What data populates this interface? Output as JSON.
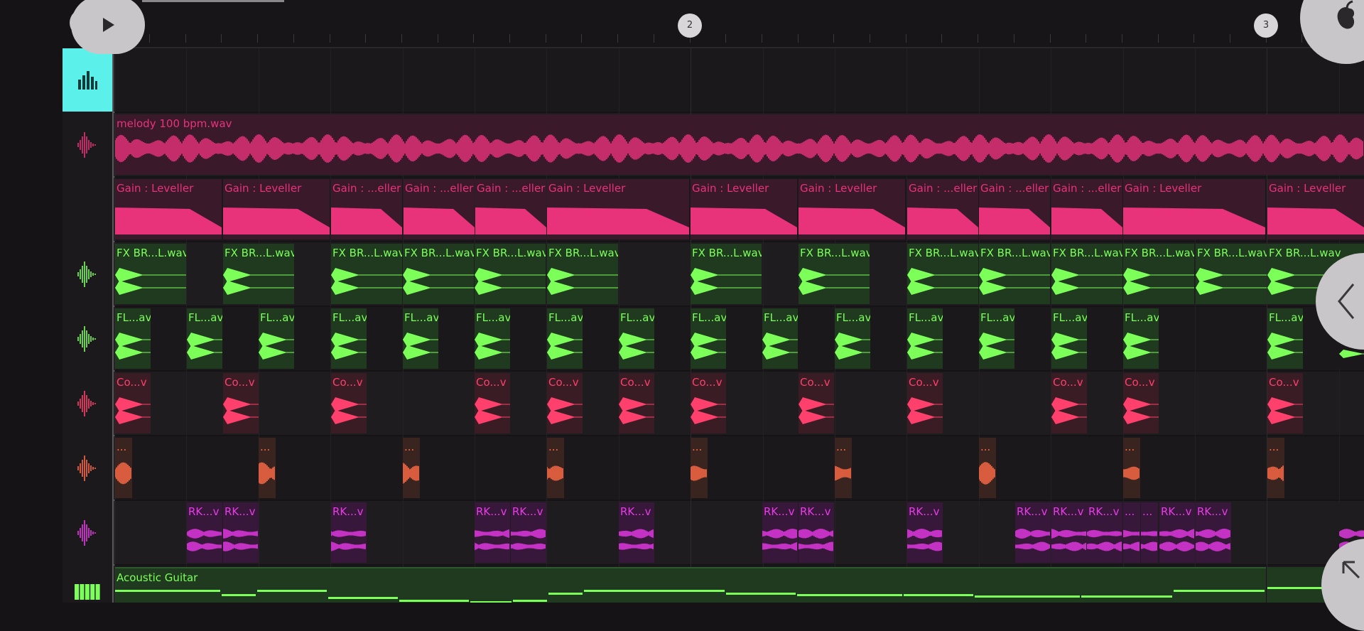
{
  "timeline": {
    "markers": [
      {
        "label": "2"
      },
      {
        "label": "3"
      }
    ]
  },
  "buttons": {
    "play_icon": "play-icon",
    "app_logo_icon": "fruit-logo-icon",
    "collapse_icon": "chevron-left-icon",
    "expand_icon": "arrow-up-left-icon",
    "mixer_icon": "mixer-icon"
  },
  "tracks": [
    {
      "id": "melody",
      "icon": "waveform-icon",
      "color": "#e8327a"
    },
    {
      "id": "gain",
      "icon": "",
      "color": "#e8327a"
    },
    {
      "id": "fx",
      "icon": "waveform-icon",
      "color": "#7dff5a"
    },
    {
      "id": "fl",
      "icon": "waveform-icon",
      "color": "#7dff5a"
    },
    {
      "id": "co",
      "icon": "waveform-icon",
      "color": "#ff3f6c"
    },
    {
      "id": "dots",
      "icon": "waveform-icon",
      "color": "#ff6a45"
    },
    {
      "id": "rk",
      "icon": "waveform-icon",
      "color": "#e83ae8"
    },
    {
      "id": "guitar",
      "icon": "piano-keys-icon",
      "color": "#7dff5a"
    }
  ],
  "clips": {
    "melody": {
      "label": "melody 100 bpm.wav"
    },
    "gain": [
      "Gain : Leveller",
      "Gain : Leveller",
      "Gain : ...eller",
      "Gain : ...eller",
      "Gain : ...eller",
      "Gain : Leveller",
      "Gain : Leveller",
      "Gain : Leveller",
      "Gain : ...eller",
      "Gain : ...eller",
      "Gain : ...eller",
      "Gain : Leveller",
      "Gain : Leveller"
    ],
    "fx": [
      "FX BR...L.wav",
      "FX BR...L.wav",
      "FX BR...L.wav",
      "FX BR...L.wav",
      "FX BR...L.wav",
      "FX BR...L.wav",
      "FX BR...L.wav",
      "FX BR...L.wav",
      "FX BR...L.wav",
      "FX BR...L.wav",
      "FX BR...L.wav",
      "FX BR...L.wav",
      "FX BR...L.wav",
      "FX BR...L.wav"
    ],
    "fl": [
      "FL...av",
      "FL...av",
      "FL...av",
      "FL...av",
      "FL...av",
      "FL...av",
      "FL...av",
      "FL...av",
      "FL...av",
      "FL...av",
      "FL...av",
      "FL...av",
      "FL...av",
      "FL...av",
      "FL...av",
      "FL...av"
    ],
    "co": [
      "Co...v",
      "Co...v",
      "Co...v",
      "Co...v",
      "Co...v",
      "Co...v",
      "Co...v",
      "Co...v",
      "Co...v",
      "Co...v",
      "Co...v",
      "Co...v"
    ],
    "dots": [
      "...",
      "...",
      "...",
      "...",
      "...",
      "...",
      "...",
      "...",
      "...",
      "..."
    ],
    "rk": [
      "RK...v",
      "RK...v",
      "RK...v",
      "RK...v",
      "RK...v",
      "RK...v",
      "RK...v",
      "RK...v",
      "RK...v",
      "RK...v",
      "RK...v",
      "RK...v",
      "...",
      "...",
      "RK...v",
      "RK...v"
    ],
    "guitar": {
      "label": "Acoustic Guitar"
    }
  }
}
